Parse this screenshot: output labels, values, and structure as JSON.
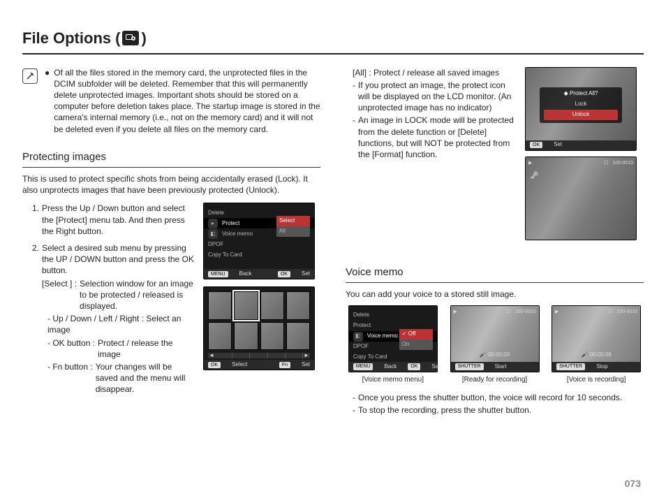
{
  "title_prefix": "File Options",
  "note_bullet": "Of all the files stored in the memory card, the unprotected files in the DCIM subfolder will be deleted. Remember that this will permanently delete unprotected images. Important shots should be stored on a computer before deletion takes place. The startup image is stored in the camera's internal memory (i.e., not on the memory card) and it will not be deleted even if you delete all files on the memory card.",
  "protect": {
    "heading": "Protecting images",
    "intro": "This is used to protect specific shots from being accidentally erased (Lock). It also unprotects images that have been previously protected (Unlock).",
    "step1": "Press the Up / Down button and select the [Protect] menu tab. And then press the Right button.",
    "step2_lead": "Select a desired sub menu by pressing the UP / DOWN button and press the OK button.",
    "select_label": "[Select ] :",
    "select_body": "Selection window for an image to be protected / released is displayed.",
    "updown": "- Up / Down / Left / Right : Select an image",
    "okbtn_label": "- OK button :",
    "okbtn_body": "Protect / release the image",
    "fnbtn_label": "- Fn button :",
    "fnbtn_body": "Your changes will be saved and the menu will disappear."
  },
  "right_top": {
    "all": "[All] : Protect / release all saved images",
    "line1": "If you protect an image, the protect icon will be displayed on the LCD monitor. (An unprotected image has no indicator)",
    "line2": "An image in LOCK mode will be protected from the delete function or [Delete] functions, but will NOT be protected from the [Format] function."
  },
  "voice": {
    "heading": "Voice memo",
    "intro": "You can add your voice to a stored still image.",
    "cap1": "[Voice memo menu]",
    "cap2": "[Ready for recording]",
    "cap3": "[Voice is recording]",
    "bul1": "Once you press the shutter button, the voice will record for 10 seconds.",
    "bul2": "To stop the recording, press the shutter button."
  },
  "menu": {
    "items": [
      "Delete",
      "Protect",
      "Voice memo",
      "DPOF",
      "Copy To Card"
    ],
    "sub_protect": [
      "Select",
      "All"
    ],
    "sub_voice": [
      "Off",
      "On"
    ],
    "off_check": "Off",
    "back": "Back",
    "set": "Set",
    "select": "Select",
    "menu_btn": "MENU",
    "ok_btn": "OK",
    "fn_btn": "Fn",
    "shutter_btn": "SHUTTER",
    "start": "Start",
    "stop": "Stop"
  },
  "overlay": {
    "title": "Protect All?",
    "lock": "Lock",
    "unlock": "Unlock"
  },
  "info": {
    "counter": "100-0010",
    "timer_zero": "00:00:00",
    "timer_rec": "00:00:06"
  },
  "page_num": "073"
}
